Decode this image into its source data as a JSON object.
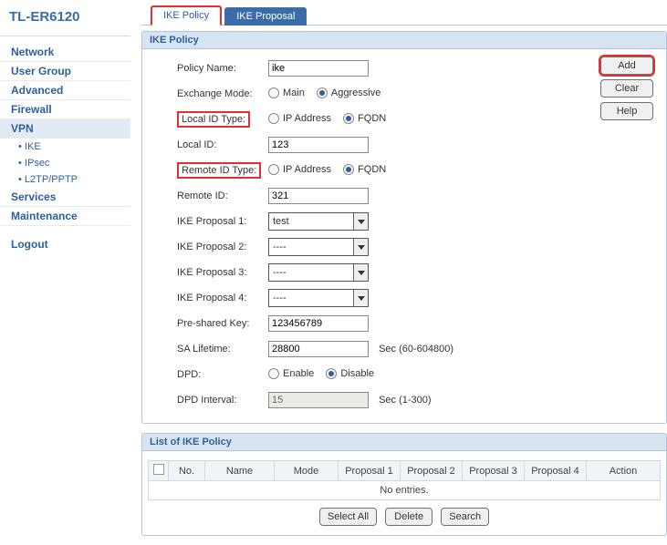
{
  "device": {
    "title": "TL-ER6120"
  },
  "tabs": {
    "policy": "IKE Policy",
    "proposal": "IKE Proposal"
  },
  "sidebar": {
    "items": [
      {
        "label": "Network"
      },
      {
        "label": "User Group"
      },
      {
        "label": "Advanced"
      },
      {
        "label": "Firewall"
      },
      {
        "label": "VPN",
        "sub": [
          {
            "label": "IKE"
          },
          {
            "label": "IPsec"
          },
          {
            "label": "L2TP/PPTP"
          }
        ]
      },
      {
        "label": "Services"
      },
      {
        "label": "Maintenance"
      },
      {
        "label": "Logout"
      }
    ]
  },
  "panel": {
    "policy_title": "IKE Policy",
    "list_title": "List of IKE Policy"
  },
  "form": {
    "policy_name": {
      "label": "Policy Name:",
      "value": "ike"
    },
    "exchange_mode": {
      "label": "Exchange Mode:",
      "opt_main": "Main",
      "opt_aggr": "Aggressive",
      "value": "Aggressive"
    },
    "local_id_type": {
      "label": "Local ID Type:",
      "opt_ip": "IP Address",
      "opt_fqdn": "FQDN",
      "value": "FQDN"
    },
    "local_id": {
      "label": "Local ID:",
      "value": "123"
    },
    "remote_id_type": {
      "label": "Remote ID Type:",
      "opt_ip": "IP Address",
      "opt_fqdn": "FQDN",
      "value": "FQDN"
    },
    "remote_id": {
      "label": "Remote ID:",
      "value": "321"
    },
    "proposal1": {
      "label": "IKE Proposal 1:",
      "value": "test"
    },
    "proposal2": {
      "label": "IKE Proposal 2:",
      "value": "----"
    },
    "proposal3": {
      "label": "IKE Proposal 3:",
      "value": "----"
    },
    "proposal4": {
      "label": "IKE Proposal 4:",
      "value": "----"
    },
    "psk": {
      "label": "Pre-shared Key:",
      "value": "123456789"
    },
    "sa_lifetime": {
      "label": "SA Lifetime:",
      "value": "28800",
      "suffix": "Sec (60-604800)"
    },
    "dpd": {
      "label": "DPD:",
      "opt_enable": "Enable",
      "opt_disable": "Disable",
      "value": "Disable"
    },
    "dpd_interval": {
      "label": "DPD Interval:",
      "value": "15",
      "suffix": "Sec (1-300)"
    }
  },
  "buttons": {
    "add": "Add",
    "clear": "Clear",
    "help": "Help",
    "select_all": "Select All",
    "delete": "Delete",
    "search": "Search"
  },
  "list": {
    "columns": {
      "no": "No.",
      "name": "Name",
      "mode": "Mode",
      "p1": "Proposal 1",
      "p2": "Proposal 2",
      "p3": "Proposal 3",
      "p4": "Proposal 4",
      "action": "Action"
    },
    "empty": "No entries."
  }
}
